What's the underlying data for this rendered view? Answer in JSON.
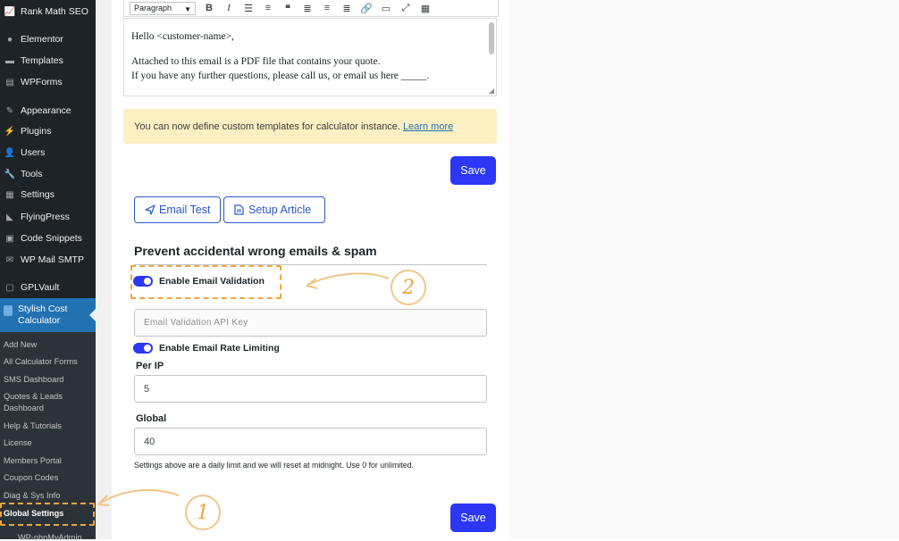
{
  "sidebar": {
    "items": [
      {
        "label": "Rank Math SEO",
        "icon": "rank-math-icon"
      },
      {
        "label": "Elementor",
        "icon": "elementor-icon"
      },
      {
        "label": "Templates",
        "icon": "folder-icon"
      },
      {
        "label": "WPForms",
        "icon": "form-icon"
      },
      {
        "label": "Appearance",
        "icon": "paintbrush-icon"
      },
      {
        "label": "Plugins",
        "icon": "plug-icon"
      },
      {
        "label": "Users",
        "icon": "users-icon"
      },
      {
        "label": "Tools",
        "icon": "wrench-icon"
      },
      {
        "label": "Settings",
        "icon": "settings-icon"
      },
      {
        "label": "FlyingPress",
        "icon": "flyingpress-icon"
      },
      {
        "label": "Code Snippets",
        "icon": "code-icon"
      },
      {
        "label": "WP Mail SMTP",
        "icon": "mail-icon"
      },
      {
        "label": "GPLVault",
        "icon": "vault-icon"
      }
    ],
    "active": {
      "label": "Stylish Cost Calculator",
      "icon": "calculator-icon"
    },
    "submenu": [
      "Add New",
      "All Calculator Forms",
      "SMS Dashboard",
      "Quotes & Leads Dashboard",
      "Help & Tutorials",
      "License",
      "Members Portal",
      "Coupon Codes",
      "Diag & Sys Info",
      "Global Settings",
      "WP-phpMyAdmin"
    ]
  },
  "editor": {
    "format": "Paragraph",
    "lines": [
      "Hello <customer-name>,",
      "Attached to this email is a PDF file that contains your quote.",
      "If you have any further questions, please call us, or email us here _____."
    ]
  },
  "notice": {
    "text": "You can now define custom templates for calculator instance.",
    "link": "Learn more"
  },
  "save_label": "Save",
  "buttons": {
    "email_test": "Email Test",
    "setup_article": "Setup Article"
  },
  "section": {
    "title": "Prevent accidental wrong emails & spam",
    "email_validation_label": "Enable Email Validation",
    "api_key_placeholder": "Email Validation API Key",
    "rate_limit_label": "Enable Email Rate Limiting",
    "per_ip_label": "Per IP",
    "per_ip_value": "5",
    "global_label": "Global",
    "global_value": "40",
    "help": "Settings above are a daily limit and we will reset at midnight. Use 0 for unlimited."
  },
  "annotations": {
    "one": "1",
    "two": "2",
    "color": "#f0a63a"
  },
  "colors": {
    "primary": "#2b37f5",
    "sidebar": "#1d2327",
    "notice": "#fcf0c3"
  }
}
